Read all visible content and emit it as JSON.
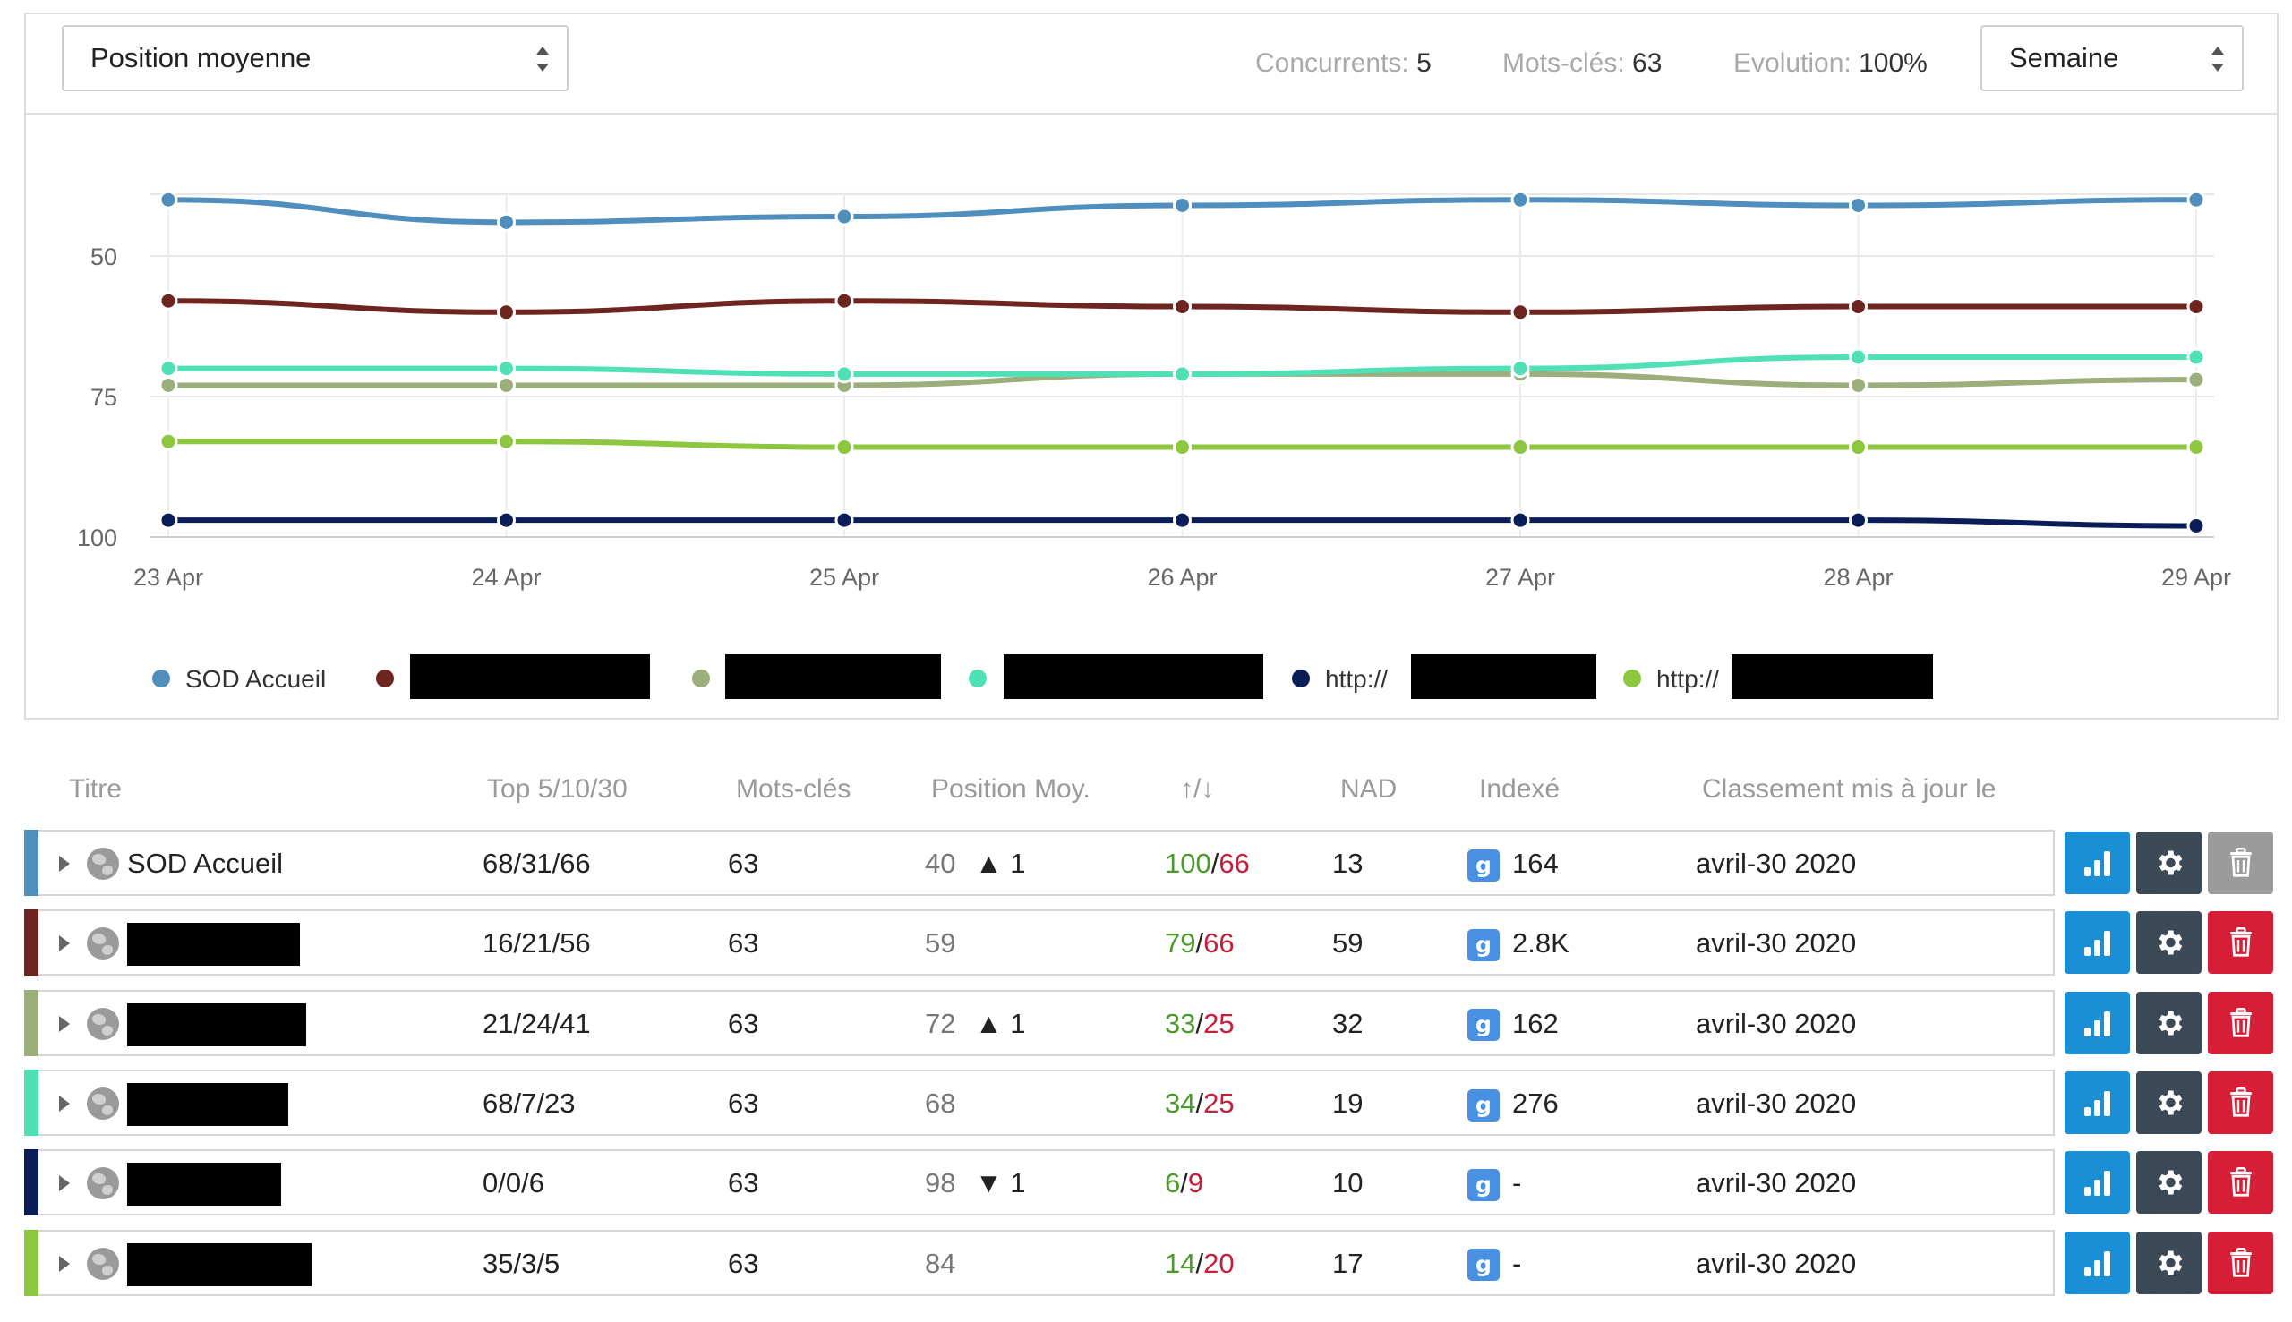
{
  "toolbar": {
    "metric_select": "Position moyenne",
    "stats": [
      {
        "label": "Concurrents:",
        "value": "5"
      },
      {
        "label": "Mots-clés:",
        "value": "63"
      },
      {
        "label": "Evolution:",
        "value": "100%"
      }
    ],
    "period_select": "Semaine"
  },
  "chart_data": {
    "type": "line",
    "x": [
      "23 Apr",
      "24 Apr",
      "25 Apr",
      "26 Apr",
      "27 Apr",
      "28 Apr",
      "29 Apr"
    ],
    "y_ticks": [
      "50",
      "75",
      "100"
    ],
    "ylim": [
      100,
      39
    ],
    "y_reversed": true,
    "grid": true,
    "legend_position": "bottom",
    "series": [
      {
        "name": "SOD Accueil",
        "color": "#4f8ebd",
        "values": [
          40,
          44,
          43,
          41,
          40,
          41,
          40
        ]
      },
      {
        "color": "#6e2520",
        "values": [
          58,
          60,
          58,
          59,
          60,
          59,
          59
        ]
      },
      {
        "color": "#9bae7c",
        "values": [
          73,
          73,
          73,
          71,
          71,
          73,
          72
        ]
      },
      {
        "color": "#4fe0b6",
        "values": [
          70,
          70,
          71,
          71,
          70,
          68,
          68
        ]
      },
      {
        "name": "http://",
        "color": "#0b1d59",
        "values": [
          97,
          97,
          97,
          97,
          97,
          97,
          98
        ]
      },
      {
        "name": "http://",
        "color": "#8dc63f",
        "values": [
          83,
          83,
          84,
          84,
          84,
          84,
          84
        ]
      }
    ]
  },
  "table": {
    "headers": [
      "Titre",
      "Top 5/10/30",
      "Mots-clés",
      "Position Moy.",
      "↑/↓",
      "NAD",
      "Indexé",
      "Classement mis à jour le"
    ],
    "rows": [
      {
        "color": "#4f8ebd",
        "title": "SOD Accueil",
        "top": "68/31/66",
        "keywords": "63",
        "pos": "40",
        "trend": "▲ 1",
        "trend_dir": "up",
        "ups": "100",
        "downs": "66",
        "nad": "13",
        "indexed": "164",
        "date": "avril-30 2020",
        "delete_disabled": true
      },
      {
        "color": "#6e2520",
        "title": "",
        "top": "16/21/56",
        "keywords": "63",
        "pos": "59",
        "trend": "",
        "trend_dir": "",
        "ups": "79",
        "downs": "66",
        "nad": "59",
        "indexed": "2.8K",
        "date": "avril-30 2020",
        "delete_disabled": false
      },
      {
        "color": "#9bae7c",
        "title": "",
        "top": "21/24/41",
        "keywords": "63",
        "pos": "72",
        "trend": "▲ 1",
        "trend_dir": "up",
        "ups": "33",
        "downs": "25",
        "nad": "32",
        "indexed": "162",
        "date": "avril-30 2020",
        "delete_disabled": false
      },
      {
        "color": "#4fe0b6",
        "title": "",
        "top": "68/7/23",
        "keywords": "63",
        "pos": "68",
        "trend": "",
        "trend_dir": "",
        "ups": "34",
        "downs": "25",
        "nad": "19",
        "indexed": "276",
        "date": "avril-30 2020",
        "delete_disabled": false
      },
      {
        "color": "#0b1d59",
        "title": "",
        "top": "0/0/6",
        "keywords": "63",
        "pos": "98",
        "trend": "▼ 1",
        "trend_dir": "down",
        "ups": "6",
        "downs": "9",
        "nad": "10",
        "indexed": "-",
        "date": "avril-30 2020",
        "delete_disabled": false
      },
      {
        "color": "#8dc63f",
        "title": "",
        "top": "35/3/5",
        "keywords": "63",
        "pos": "84",
        "trend": "",
        "trend_dir": "",
        "ups": "14",
        "downs": "20",
        "nad": "17",
        "indexed": "-",
        "date": "avril-30 2020",
        "delete_disabled": false
      }
    ],
    "google_badge": "g"
  },
  "icons": {
    "stats": "bar-chart-icon",
    "settings": "gear-icon",
    "delete": "trash-icon",
    "site": "globe-icon",
    "expand": "caret-right-icon"
  }
}
